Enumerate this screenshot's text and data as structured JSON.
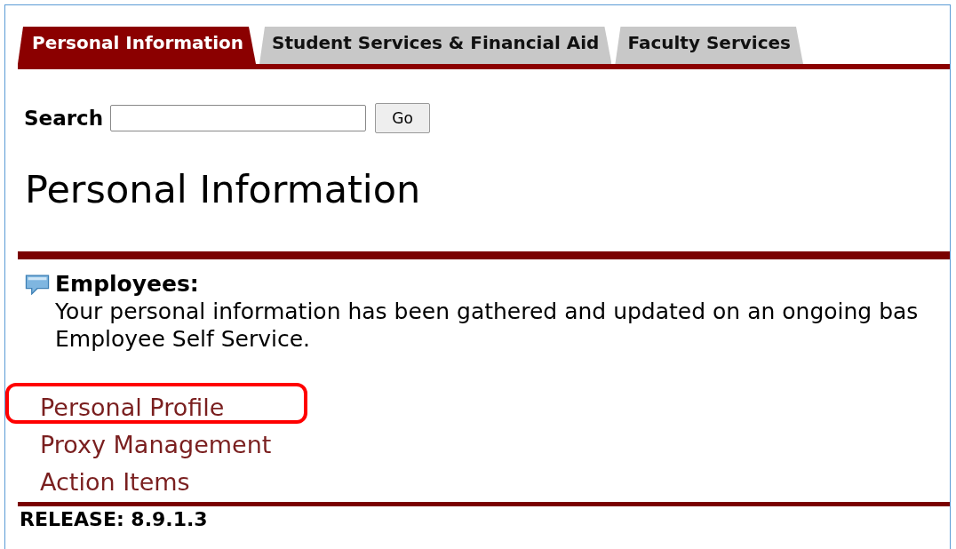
{
  "tabs": [
    {
      "label": "Personal Information",
      "selected": true
    },
    {
      "label": "Student Services & Financial Aid",
      "selected": false
    },
    {
      "label": "Faculty Services",
      "selected": false
    }
  ],
  "search": {
    "label": "Search",
    "button": "Go"
  },
  "heading": "Personal Information",
  "info": {
    "title": "Employees:",
    "lines": [
      "Your personal information has been gathered and updated on an ongoing bas",
      "Employee Self Service."
    ]
  },
  "links": [
    {
      "label": "Personal Profile",
      "highlighted": true
    },
    {
      "label": "Proxy Management",
      "highlighted": false
    },
    {
      "label": "Action Items",
      "highlighted": false
    }
  ],
  "release": "RELEASE: 8.9.1.3"
}
